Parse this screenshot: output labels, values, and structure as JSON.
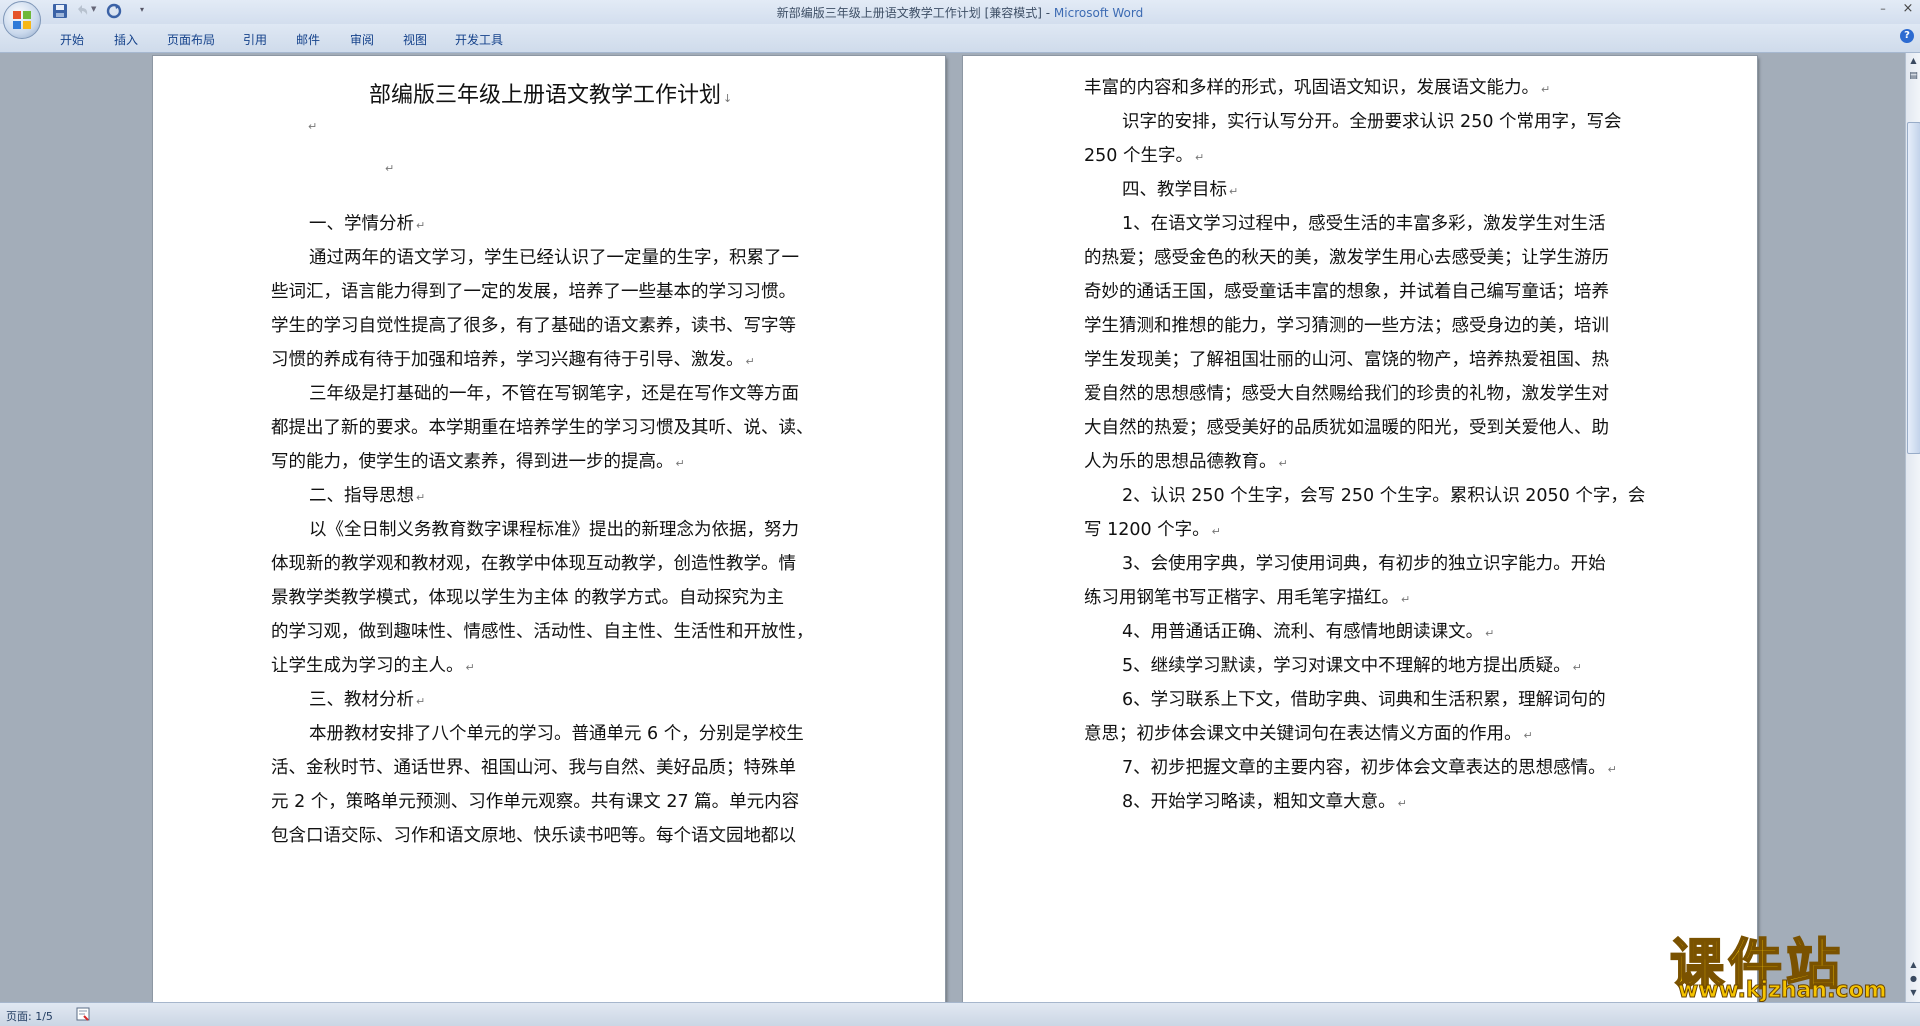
{
  "window": {
    "title_doc": "新部编版三年级上册语文教学工作计划 [兼容模式] - ",
    "title_app": "Microsoft Word",
    "minimize": "–",
    "close": "×"
  },
  "ribbon": {
    "tabs": [
      "开始",
      "插入",
      "页面布局",
      "引用",
      "邮件",
      "审阅",
      "视图",
      "开发工具"
    ],
    "help": "?"
  },
  "document": {
    "title": "部编版三年级上册语文教学工作计划",
    "left_lines": [
      "一、学情分析",
      "通过两年的语文学习，学生已经认识了一定量的生字，积累了一",
      "些词汇，语言能力得到了一定的发展，培养了一些基本的学习习惯。",
      "学生的学习自觉性提高了很多，有了基础的语文素养，读书、写字等",
      "习惯的养成有待于加强和培养，学习兴趣有待于引导、激发。",
      "三年级是打基础的一年，不管在写钢笔字，还是在写作文等方面",
      "都提出了新的要求。本学期重在培养学生的学习习惯及其听、说、读、",
      "写的能力，使学生的语文素养，得到进一步的提高。",
      "二、指导思想",
      "以《全日制义务教育数字课程标准》提出的新理念为依据，努力",
      "体现新的教学观和教材观，在教学中体现互动教学，创造性教学。情",
      "景教学类教学模式，体现以学生为主体 的教学方式。自动探究为主",
      "的学习观，做到趣味性、情感性、活动性、自主性、生活性和开放性，",
      "让学生成为学习的主人。",
      "三、教材分析",
      "本册教材安排了八个单元的学习。普通单元 6 个，分别是学校生",
      "活、金秋时节、通话世界、祖国山河、我与自然、美好品质；特殊单",
      "元 2 个，策略单元预测、习作单元观察。共有课文 27 篇。单元内容",
      "包含口语交际、习作和语文原地、快乐读书吧等。每个语文园地都以"
    ],
    "right_lines": [
      "丰富的内容和多样的形式，巩固语文知识，发展语文能力。",
      "识字的安排，实行认写分开。全册要求认识 250 个常用字，写会",
      "250 个生字。",
      "四、教学目标",
      "1、在语文学习过程中，感受生活的丰富多彩，激发学生对生活",
      "的热爱；感受金色的秋天的美，激发学生用心去感受美；让学生游历",
      "奇妙的通话王国，感受童话丰富的想象，并试着自己编写童话；培养",
      "学生猜测和推想的能力，学习猜测的一些方法；感受身边的美，培训",
      "学生发现美；了解祖国壮丽的山河、富饶的物产，培养热爱祖国、热",
      "爱自然的思想感情；感受大自然赐给我们的珍贵的礼物，激发学生对",
      "大自然的热爱；感受美好的品质犹如温暖的阳光，受到关爱他人、助",
      "人为乐的思想品德教育。",
      "2、认识 250 个生字，会写 250 个生字。累积认识 2050 个字，会",
      "写 1200 个字。",
      "3、会使用字典，学习使用词典，有初步的独立识字能力。开始",
      "练习用钢笔书写正楷字、用毛笔字描红。",
      "4、用普通话正确、流利、有感情地朗读课文。",
      "5、继续学习默读，学习对课文中不理解的地方提出质疑。",
      "6、学习联系上下文，借助字典、词典和生活积累，理解词句的",
      "意思；初步体会课文中关键词句在表达情义方面的作用。",
      "7、初步把握文章的主要内容，初步体会文章表达的思想感情。",
      "8、开始学习略读，粗知文章大意。"
    ]
  },
  "statusbar": {
    "page": "页面: 1/5"
  },
  "watermark": {
    "name": "课件站",
    "url": "www.kjzhan.com"
  },
  "colors": {
    "ribbon_text": "#15428b",
    "app_name": "#3d6bb3",
    "workspace": "#a3adb9",
    "watermark": "#f5c400"
  }
}
